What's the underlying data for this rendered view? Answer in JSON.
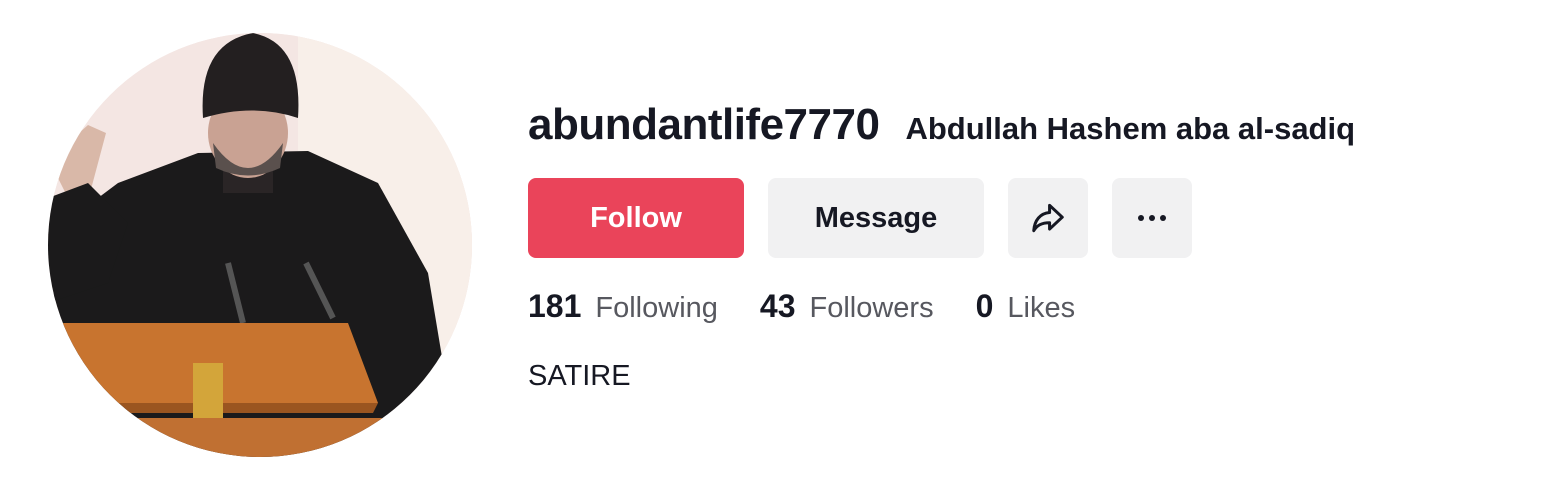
{
  "profile": {
    "username": "abundantlife7770",
    "nickname": "Abdullah Hashem aba al-sadiq",
    "bio": "SATIRE"
  },
  "actions": {
    "follow_label": "Follow",
    "message_label": "Message",
    "share_icon": "share-arrow-icon",
    "more_icon": "more-dots-icon"
  },
  "stats": {
    "following_count": "181",
    "following_label": "Following",
    "followers_count": "43",
    "followers_label": "Followers",
    "likes_count": "0",
    "likes_label": "Likes"
  },
  "colors": {
    "follow_button": "#ea445a",
    "secondary_button": "#f1f1f2",
    "text_primary": "#161823",
    "text_secondary": "#57585f"
  }
}
